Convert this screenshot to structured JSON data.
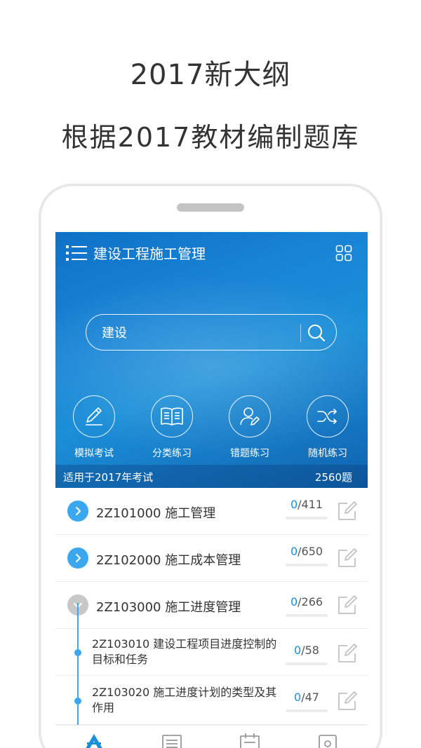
{
  "promo": {
    "headline": "2017新大纲",
    "subheadline": "根据2017教材编制题库"
  },
  "app": {
    "title": "建设工程施工管理",
    "search": {
      "value": "建设"
    },
    "features": [
      {
        "label": "模拟考试",
        "icon": "pencil-icon"
      },
      {
        "label": "分类练习",
        "icon": "book-icon"
      },
      {
        "label": "错题练习",
        "icon": "user-edit-icon"
      },
      {
        "label": "随机练习",
        "icon": "shuffle-icon"
      }
    ],
    "info": {
      "applies_to": "适用于2017年考试",
      "total": "2560题"
    },
    "chapters": [
      {
        "title": "2Z101000 施工管理",
        "done": "0",
        "total": "/411",
        "expanded": false
      },
      {
        "title": "2Z102000 施工成本管理",
        "done": "0",
        "total": "/650",
        "expanded": false
      },
      {
        "title": "2Z103000 施工进度管理",
        "done": "0",
        "total": "/266",
        "expanded": true
      }
    ],
    "sections": [
      {
        "title": "2Z103010 建设工程项目进度控制的目标和任务",
        "done": "0",
        "total": "/58"
      },
      {
        "title": "2Z103020 施工进度计划的类型及其作用",
        "done": "0",
        "total": "/47"
      }
    ],
    "colors": {
      "accent": "#1a8fd9",
      "chevron_active": "#3ba7ee",
      "chevron_collapsed": "#c8c8c8"
    }
  }
}
